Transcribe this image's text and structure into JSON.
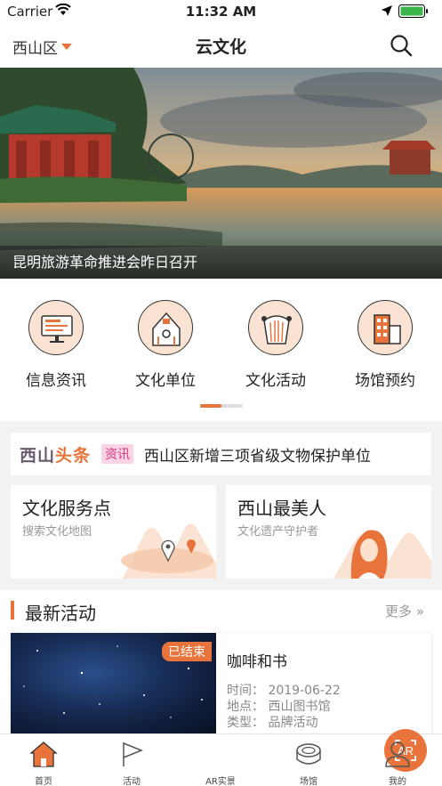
{
  "status_bar": {
    "carrier": "Carrier",
    "time": "11:32 AM"
  },
  "nav": {
    "district": "西山区",
    "title": "云文化"
  },
  "banner": {
    "caption": "昆明旅游革命推进会昨日召开"
  },
  "quick_menu": [
    {
      "label": "信息资讯",
      "icon": "monitor-icon"
    },
    {
      "label": "文化单位",
      "icon": "house-icon"
    },
    {
      "label": "文化活动",
      "icon": "harp-icon"
    },
    {
      "label": "场馆预约",
      "icon": "building-icon"
    }
  ],
  "headline": {
    "logo_part1": "西山",
    "logo_part2": "头条",
    "tag": "资讯",
    "text": "西山区新增三项省级文物保护单位"
  },
  "cards": [
    {
      "title": "文化服务点",
      "subtitle": "搜索文化地图"
    },
    {
      "title": "西山最美人",
      "subtitle": "文化遗产守护者"
    }
  ],
  "latest": {
    "title": "最新活动",
    "more": "更多 »"
  },
  "activity": {
    "badge": "已结束",
    "name": "咖啡和书",
    "time": "时间： 2019-06-22",
    "place": "地点： 西山图书馆",
    "type": "类型： 品牌活动"
  },
  "tabbar": {
    "home": "首页",
    "activities": "活动",
    "ar": "AR实景",
    "ar_badge": "AR",
    "venues": "场馆",
    "mine": "我的"
  },
  "colors": {
    "accent": "#e8743b",
    "icon_fill": "#fbe3d4"
  }
}
